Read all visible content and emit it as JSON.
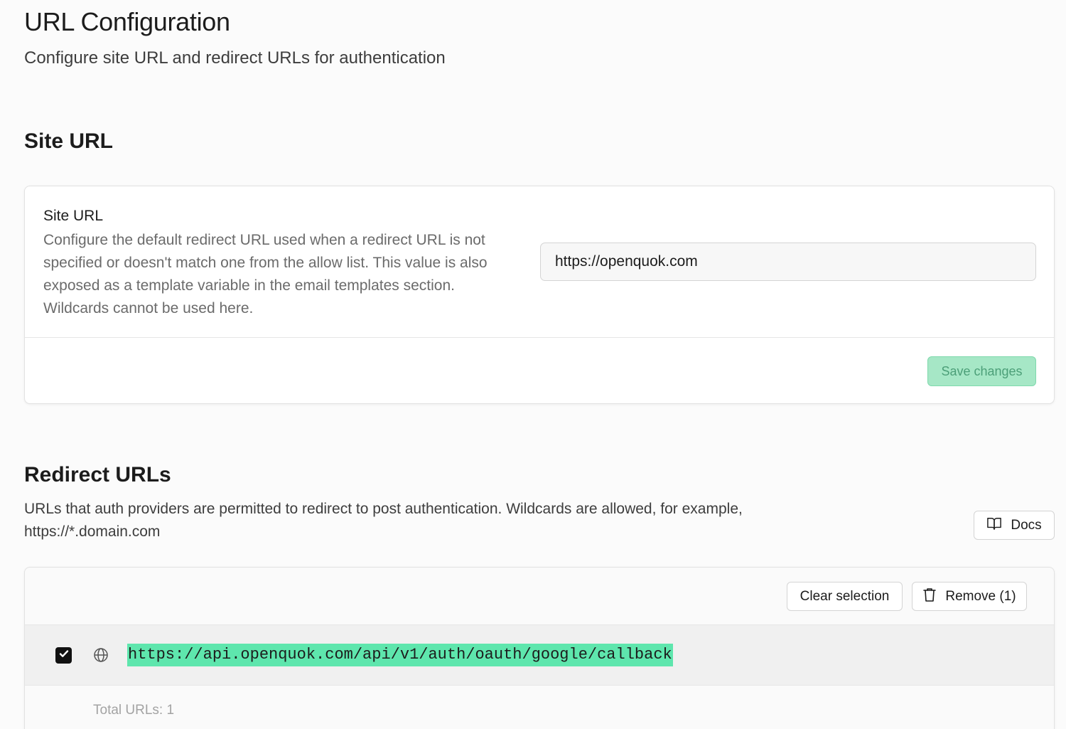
{
  "header": {
    "title": "URL Configuration",
    "subtitle": "Configure site URL and redirect URLs for authentication"
  },
  "site_url_section": {
    "title": "Site URL",
    "field_label": "Site URL",
    "field_description": "Configure the default redirect URL used when a redirect URL is not specified or doesn't match one from the allow list. This value is also exposed as a template variable in the email templates section. Wildcards cannot be used here.",
    "input_value": "https://openquok.com",
    "save_label": "Save changes"
  },
  "redirect_section": {
    "title": "Redirect URLs",
    "description": "URLs that auth providers are permitted to redirect to post authentication. Wildcards are allowed, for example, https://*.domain.com",
    "docs_label": "Docs",
    "clear_selection_label": "Clear selection",
    "remove_label": "Remove (1)",
    "urls": [
      {
        "url": "https://api.openquok.com/api/v1/auth/oauth/google/callback",
        "selected": true
      }
    ],
    "total_label": "Total URLs: 1"
  },
  "icons": {
    "docs": "book-open-icon",
    "remove": "trash-icon",
    "row": "globe-icon",
    "checkbox": "check-icon"
  },
  "colors": {
    "brand_green": "#3ecf8e",
    "save_button_bg": "#a6e7c6",
    "url_highlight": "#5ee6ad"
  }
}
